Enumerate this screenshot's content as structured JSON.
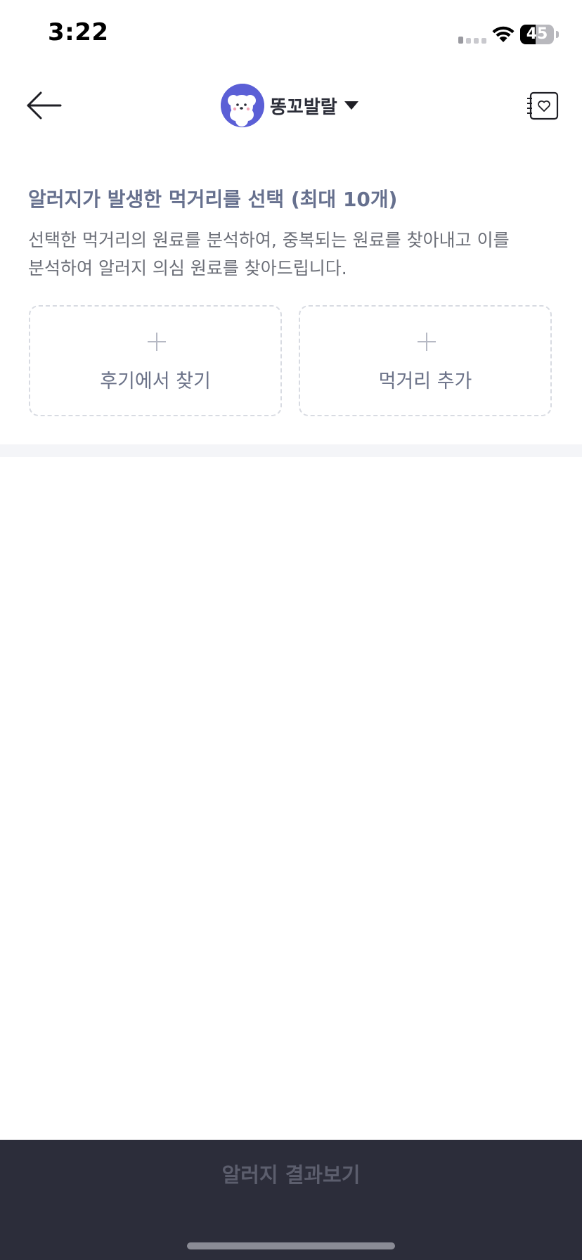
{
  "status_bar": {
    "time": "3:22",
    "battery_level": "45",
    "icons": [
      "signal-icon",
      "wifi-icon",
      "battery-icon"
    ]
  },
  "header": {
    "back_icon": "arrow-left-icon",
    "profile_name": "똥꼬발랄",
    "avatar_icon": "puppy-avatar",
    "dropdown_icon": "caret-down-icon",
    "favorites_icon": "heart-notebook-icon",
    "avatar_color": "#5b5fd6"
  },
  "main": {
    "title": "알러지가 발생한 먹거리를 선택 (최대 10개)",
    "description": "선택한 먹거리의 원료를 분석하여, 중복되는 원료를 찾아내고 이를 분석하여 알러지 의심 원료를 찾아드립니다.",
    "cards": [
      {
        "label": "후기에서 찾기",
        "icon": "plus-icon"
      },
      {
        "label": "먹거리 추가",
        "icon": "plus-icon"
      }
    ]
  },
  "bottom": {
    "button_label": "알러지 결과보기",
    "button_enabled": false,
    "bar_color": "#2c2d3a"
  }
}
